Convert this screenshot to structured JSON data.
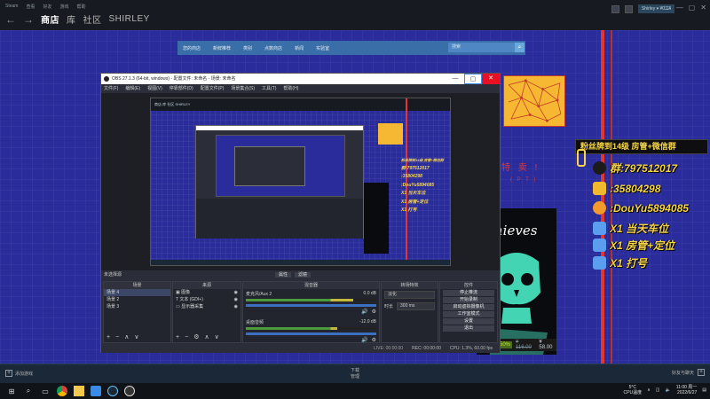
{
  "steam": {
    "menu": [
      "Steam",
      "查看",
      "好友",
      "游戏",
      "帮助"
    ],
    "nav": {
      "back": "←",
      "forward": "→",
      "tabs": [
        "商店",
        "库",
        "社区",
        "SHIRLEY"
      ],
      "active_index": 0
    },
    "account": {
      "user": "Shirley ▾ ¥0.14"
    },
    "window_controls": [
      "▭",
      "—",
      "▢",
      "✕"
    ],
    "store_menu": [
      "您的商店",
      "新鲜推荐",
      "类别",
      "点数商店",
      "新闻",
      "实验室"
    ],
    "search": {
      "placeholder": "搜索"
    },
    "promo_title": "特 卖 !",
    "promo_sub": "( P T )",
    "game_title": "Thieves",
    "price": {
      "discount": "-50%",
      "original": "¥ 116.00",
      "final": "¥ 58.00"
    },
    "bottom": {
      "add_game": "添加游戏",
      "downloads_title": "下载",
      "downloads_sub": "管理",
      "friends": "好友与聊天"
    }
  },
  "overlay": {
    "header": "粉丝牌到14级 房管+微信群",
    "rows": [
      {
        "icon": "qq-icon",
        "text": "群:797512017",
        "color": "#1b1b1b"
      },
      {
        "icon": "bilibili-icon",
        "text": ":35804298",
        "color": "#f0b82d"
      },
      {
        "icon": "douyu-icon",
        "text": ":DouYu5894085",
        "color": "#f39a2c"
      },
      {
        "icon": "car-icon",
        "text": "X1  当天车位",
        "color": "#5b9ef0"
      },
      {
        "icon": "manager-icon",
        "text": "X1  房管+定位",
        "color": "#5b9ef0"
      },
      {
        "icon": "hit-icon",
        "text": "X1  打号",
        "color": "#5b9ef0"
      }
    ]
  },
  "obs": {
    "title": "OBS 27.1.3 (64-bit, windows) - 配置文件: 未命名 - 场景: 未命名",
    "menu": [
      "文件(F)",
      "编辑(E)",
      "视图(V)",
      "停靠部件(D)",
      "配置文件(P)",
      "场景集合(S)",
      "工具(T)",
      "帮助(H)"
    ],
    "window_controls": [
      "—",
      "▢",
      "✕"
    ],
    "source_status": "未选择源",
    "filter_buttons": [
      "属性",
      "滤镜"
    ],
    "scenes": {
      "header": "场景",
      "items": [
        "场景 4",
        "场景 2",
        "场景 3"
      ],
      "selected": 0
    },
    "sources": {
      "header": "来源",
      "items": [
        "图像",
        "文本 (GDI+)",
        "显示器采集"
      ]
    },
    "mixer": {
      "header": "混音器",
      "tracks": [
        {
          "name": "麦克风/Aux 2",
          "db": "0.0 dB",
          "level": 0.82
        },
        {
          "name": "桌面音频",
          "db": "-12.0 dB",
          "level": 0.7
        }
      ]
    },
    "transitions": {
      "header": "转场特效",
      "type": "淡化",
      "duration_label": "时长",
      "duration": "300 ms"
    },
    "controls": {
      "header": "控件",
      "buttons": [
        "停止推流",
        "开始录制",
        "启动虚拟摄像机",
        "工作室模式",
        "设置",
        "退出"
      ]
    },
    "statusbar": {
      "live": "LIVE: 00:00:00",
      "rec": "REC: 00:00:00",
      "cpu": "CPU: 1.3%, 60.00 fps"
    }
  },
  "inner": {
    "topbar": "商店  库  社区  SHIRLEY",
    "overlay": [
      "群:797512017",
      ":35804298",
      ":DouYu5894085",
      "X1 当天车位",
      "X1 房管+定位",
      "X1 打号"
    ],
    "overlay_header": "粉丝牌到14级 房管+微信群"
  },
  "taskbar": {
    "weather": "5°C",
    "weather_sub": "CPU温度",
    "time": "11:00 周一",
    "date": "2022/6/27"
  }
}
